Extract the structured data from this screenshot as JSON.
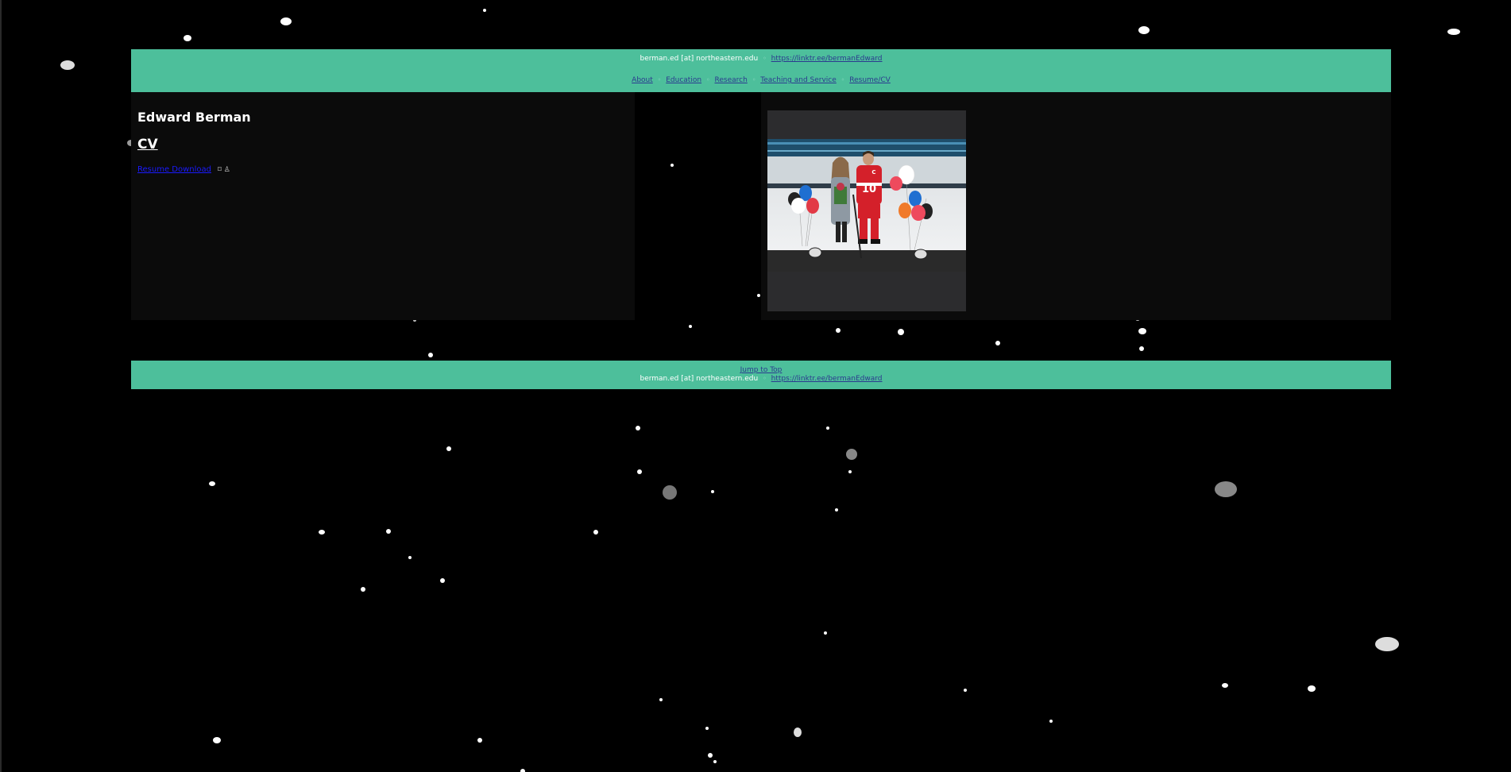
{
  "header": {
    "email": "berman.ed [at] northeastern.edu",
    "separator": "◦",
    "link": "https://linktr.ee/bermanEdward",
    "nav": [
      {
        "label": "About"
      },
      {
        "label": "Education"
      },
      {
        "label": "Research"
      },
      {
        "label": "Teaching and Service"
      },
      {
        "label": "Resume/CV"
      }
    ]
  },
  "main": {
    "name": "Edward Berman",
    "section_title": "CV",
    "resume_link": "Resume Download",
    "resume_icons": "⌑ ♙"
  },
  "photo": {
    "jersey_number": "10",
    "jersey_letter": "C"
  },
  "footer": {
    "jump": "Jump to Top",
    "email": "berman.ed [at] northeastern.edu",
    "separator": "◦",
    "link": "https://linktr.ee/bermanEdward"
  },
  "colors": {
    "accent": "#4dbf9b",
    "panel": "#0b0b0b",
    "background": "#000000",
    "link": "#1a1aff"
  }
}
